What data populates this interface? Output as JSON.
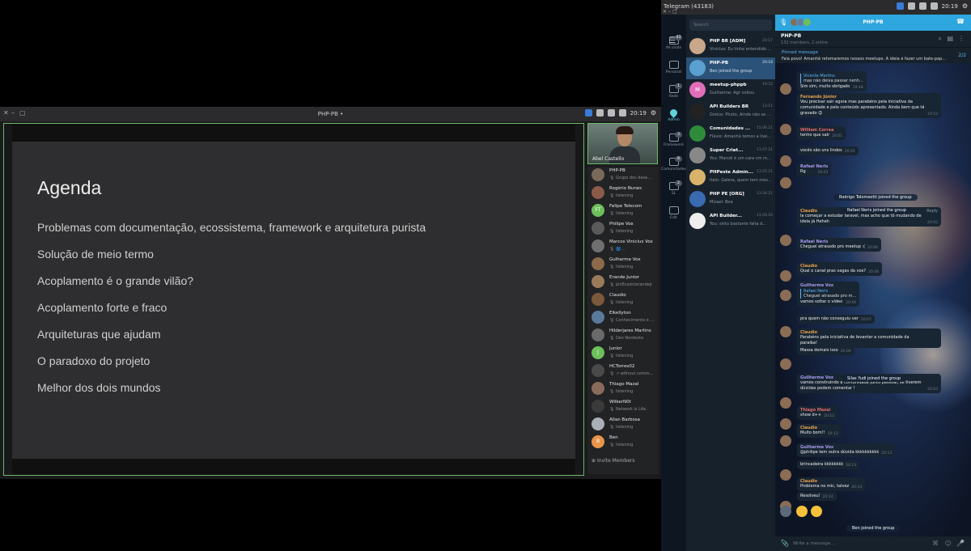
{
  "voice_window": {
    "title": "PHP-PB •",
    "tray_time": "20:19",
    "slide": {
      "title": "Agenda",
      "items": [
        "Problemas com documentação, ecossistema, framework e arquitetura purista",
        "Solução de meio termo",
        "Acoplamento é o grande vilão?",
        "Acoplamento forte e fraco",
        "Arquiteturas que ajudam",
        "O paradoxo do projeto",
        "Melhor dos dois mundos"
      ]
    },
    "camera_name": "Abel Castello",
    "participants": [
      {
        "name": "PHP-PB",
        "status": "Grupo dos dese...",
        "initials": "",
        "color": "#7a6a5a"
      },
      {
        "name": "Rogério Nunes",
        "status": "listening",
        "initials": "",
        "color": "#8a5a4a"
      },
      {
        "name": "Felipe Telecom",
        "status": "listening",
        "initials": "FT",
        "color": "#6cbf5a"
      },
      {
        "name": "Philipe Vox",
        "status": "listening",
        "initials": "",
        "color": "#5a5a5a"
      },
      {
        "name": "Marcos Vinicius Vox",
        "status": "🌀...",
        "initials": "",
        "color": "#707070"
      },
      {
        "name": "Gulherme Vox",
        "status": "listening",
        "initials": "",
        "color": "#8a6a4a"
      },
      {
        "name": "Erande Junior",
        "status": "pinEcash/erandejr",
        "initials": "",
        "color": "#9a7a5a"
      },
      {
        "name": "Claudio",
        "status": "listening",
        "initials": "",
        "color": "#7a5a3a"
      },
      {
        "name": "Elkellyton",
        "status": "Conhecimento é ...",
        "initials": "",
        "color": "#5a7a9a"
      },
      {
        "name": "Hilderjares Martins",
        "status": "Dev Nordeste",
        "initials": "",
        "color": "#6a6a6a"
      },
      {
        "name": "Junior",
        "status": "listening",
        "initials": "J",
        "color": "#6cbf5a"
      },
      {
        "name": "HCTorres02",
        "status": "↗ without comm...",
        "initials": "",
        "color": "#4a4a4a"
      },
      {
        "name": "Thiago Mazal",
        "status": "listening",
        "initials": "",
        "color": "#8a6a5a"
      },
      {
        "name": "WilkerN0t",
        "status": "Network is Life.",
        "initials": "",
        "color": "#3a3a3a"
      },
      {
        "name": "Allan Barbosa",
        "status": "listening",
        "initials": "",
        "color": "#aab0b8"
      },
      {
        "name": "Ben",
        "status": "listening",
        "initials": "B",
        "color": "#e8954a"
      }
    ],
    "invite_label": "Invite Members"
  },
  "telegram": {
    "title": "Telegram (43183)",
    "tray_time": "20:19",
    "folders": [
      {
        "label": "All chats",
        "badge": "43"
      },
      {
        "label": "Personal",
        "badge": ""
      },
      {
        "label": "Rede",
        "badge": "1"
      },
      {
        "label": "Admin",
        "badge": ""
      },
      {
        "label": "Framework",
        "badge": "3"
      },
      {
        "label": "Comunidades",
        "badge": "8"
      },
      {
        "label": "SL",
        "badge": "2"
      },
      {
        "label": "Edit",
        "badge": ""
      }
    ],
    "search_placeholder": "Search",
    "chats": [
      {
        "name": "PHP BR [ADM]",
        "preview": "Vinicius: Eu tinha entendido ...",
        "time": "20:17",
        "initials": "",
        "color": "#c9a88a"
      },
      {
        "name": "PHP-PB",
        "preview": "Ben joined the group",
        "time": "20:18",
        "initials": "",
        "color": "#5aa0d0",
        "selected": true
      },
      {
        "name": "meetup-phppb",
        "preview": "Guilherme: Agr voltou",
        "time": "19:52",
        "initials": "M",
        "color": "#e16db8"
      },
      {
        "name": "API Builders BR",
        "preview": "Greice: Photo, Ainda não se ...",
        "time": "13:11",
        "initials": "",
        "color": "#222"
      },
      {
        "name": "Comunidades ...",
        "preview": "Flávio: Amanhã temos a live...",
        "time": "15.06.21",
        "initials": "",
        "color": "#2e8b3a"
      },
      {
        "name": "Super Criat...",
        "preview": "You: Marcel é um cara cm m...",
        "time": "13.07.21",
        "initials": "",
        "color": "#888"
      },
      {
        "name": "PHPeste Admin...",
        "preview": "Ítalo: Galera, quem tem mes...",
        "time": "13.05.21",
        "initials": "",
        "color": "#d9b36a"
      },
      {
        "name": "PHP PE [ORG]",
        "preview": "Mizael: Boa",
        "time": "13.04.21",
        "initials": "",
        "color": "#3a6ab0"
      },
      {
        "name": "API Builder...",
        "preview": "You: sinto bastante falta d...",
        "time": "11.09.20",
        "initials": "",
        "color": "#eee"
      }
    ],
    "call_title": "PHP-PB",
    "group_name": "PHP-PB",
    "group_status": "132 members, 2 online",
    "pinned_label": "Pinned message",
    "pinned_text": "Fala povo! Amanhã retomaremos nossos meetups. A ideia é fazer um bate-pap...",
    "pinned_count": "2/2",
    "messages": [
      {
        "author": "",
        "quote_name": "Vicente Martins",
        "quote_text": "mas não deixa passar nenh...",
        "text": "Sim sim, muito obrigado",
        "time": "19:48",
        "color": "#6bd37a"
      },
      {
        "author": "Fernando Júnior",
        "text": "Vou precisar sair agora mas parabéns pela iniciativa da comunidade e pelo conteúdo apresentado. Ainda bem que tá gravado 😊",
        "time": "19:53",
        "color": "#e5a04d"
      },
      {
        "author": "William Correa",
        "text": "tenho que sair",
        "time": "20:01",
        "color": "#e06a6a"
      },
      {
        "author": "",
        "text": "vocês são uns lindos",
        "time": "20:01",
        "color": "#e06a6a"
      },
      {
        "author": "Rafael Neris",
        "text": "Rg",
        "time": "20:03",
        "color": "#a79af0"
      },
      {
        "author": "Claudio",
        "text": "la começar a estudar laravel, mas acho que tô mudando de ideia já Heheh",
        "time": "20:05",
        "color": "#e5a04d",
        "reply": "Reply"
      },
      {
        "author": "Rafael Neris",
        "text": "Cheguei atrasado pro meetup :(",
        "time": "20:06",
        "color": "#a79af0"
      },
      {
        "author": "Claudio",
        "text": "Qual o canal pras vagas da vox?",
        "time": "20:06",
        "color": "#e5a04d"
      },
      {
        "author": "Guilherme Vox",
        "quote_name": "Rafael Neris",
        "quote_text": "Cheguei atrasado pro m...",
        "text": "vamos soltar o vídeo",
        "time": "20:06",
        "color": "#a79af0"
      },
      {
        "author": "",
        "text": "pra quem não conseguiu ver",
        "time": "20:07",
        "color": "#a79af0"
      },
      {
        "author": "Claudio",
        "text": "Parabéns pela iniciativa de levantar a comunidade da paraiba!",
        "time": "",
        "color": "#e5a04d"
      },
      {
        "author": "",
        "text": "Massa demais isso",
        "time": "20:09",
        "color": "#e5a04d"
      },
      {
        "author": "Guilherme Vox",
        "text": "vamos construindo a comunidade junto pessoal, se tiverem dúvidas podem comentar !",
        "time": "20:10",
        "color": "#a79af0"
      },
      {
        "author": "Thiago Mazal",
        "text": "show d++",
        "time": "20:12",
        "color": "#e06a6a"
      },
      {
        "author": "Claudio",
        "text": "Muito bom!!",
        "time": "20:12",
        "color": "#e5a04d"
      },
      {
        "author": "Guilherme Vox",
        "text": "@philipe tem outra dúvida kkkkkkkkkk",
        "time": "20:13",
        "color": "#a79af0"
      },
      {
        "author": "",
        "text": "brincadeira kkkkkkkk",
        "time": "20:13",
        "color": "#a79af0"
      },
      {
        "author": "Claudio",
        "text": "Problema no mic, talvez",
        "time": "20:14",
        "color": "#e5a04d"
      },
      {
        "author": "",
        "text": "Resolveu!",
        "time": "20:14",
        "color": "#e5a04d"
      }
    ],
    "service_messages": [
      "Rodrigo Tolomeotti joined the group",
      "Rafael Neris joined the group",
      "Silas Yudi joined the group",
      "Ben joined the group"
    ],
    "composer_placeholder": "Write a message..."
  }
}
